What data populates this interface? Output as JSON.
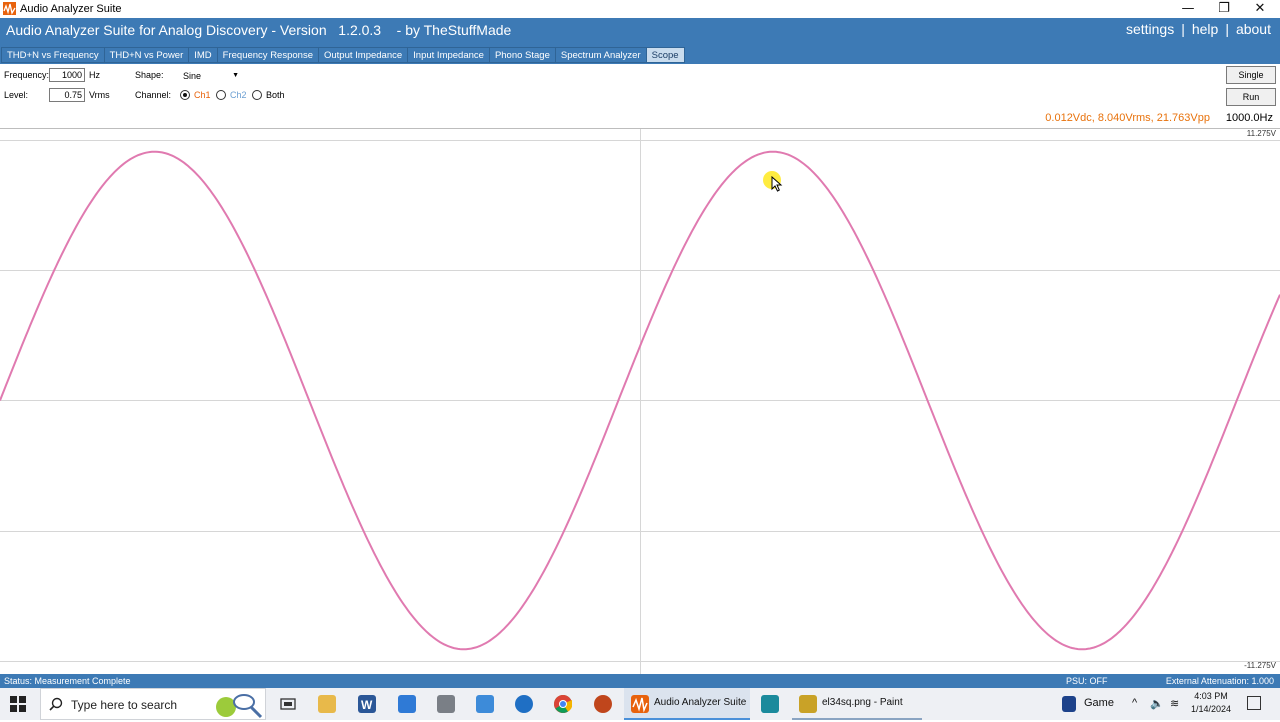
{
  "window": {
    "title": "Audio Analyzer Suite",
    "minimize_glyph": "—",
    "restore_glyph": "❐",
    "close_glyph": "✕"
  },
  "header": {
    "app_title": "Audio Analyzer Suite for Analog Discovery - Version   1.2.0.3    - by TheStuffMade",
    "nav": {
      "settings": "settings",
      "help": "help",
      "about": "about",
      "separator": "|"
    }
  },
  "tabs": [
    {
      "label": "THD+N vs Frequency",
      "active": false
    },
    {
      "label": "THD+N vs Power",
      "active": false
    },
    {
      "label": "IMD",
      "active": false
    },
    {
      "label": "Frequency Response",
      "active": false
    },
    {
      "label": "Output Impedance",
      "active": false
    },
    {
      "label": "Input Impedance",
      "active": false
    },
    {
      "label": "Phono Stage",
      "active": false
    },
    {
      "label": "Spectrum Analyzer",
      "active": false
    },
    {
      "label": "Scope",
      "active": true
    }
  ],
  "controls": {
    "frequency_label": "Frequency:",
    "frequency_value": "1000",
    "frequency_unit": "Hz",
    "level_label": "Level:",
    "level_value": "0.75",
    "level_unit": "Vrms",
    "shape_label": "Shape:",
    "shape_value": "Sine",
    "channel_label": "Channel:",
    "channel_options": [
      "Ch1",
      "Ch2",
      "Both"
    ],
    "channel_selected": "Ch1",
    "single_button": "Single",
    "run_button": "Run"
  },
  "readout": {
    "measurement": "0.012Vdc, 8.040Vrms, 21.763Vpp",
    "frequency": "1000.0Hz"
  },
  "scope": {
    "vmax_label": "11.275V",
    "vmin_label": "-11.275V",
    "trace_color": "#e07ab0",
    "amplitude_fraction": 0.955,
    "visible_periods": 2.07
  },
  "statusbar": {
    "status": "Status: Measurement Complete",
    "psu": "PSU: OFF",
    "attenuation": "External Attenuation: 1.000"
  },
  "taskbar": {
    "search_placeholder": "Type here to search",
    "running_apps": [
      {
        "label": "Audio Analyzer Suite",
        "icon": "audio-analyzer-icon"
      },
      {
        "label": "el34sq.png - Paint",
        "icon": "paint-icon"
      }
    ],
    "game_label": "Game",
    "time": "4:03 PM",
    "date": "1/14/2024"
  },
  "colors": {
    "accent": "#3d7ab5",
    "readout": "#e8720c",
    "ch1": "#e8620c",
    "ch2": "#6b9fd2"
  }
}
